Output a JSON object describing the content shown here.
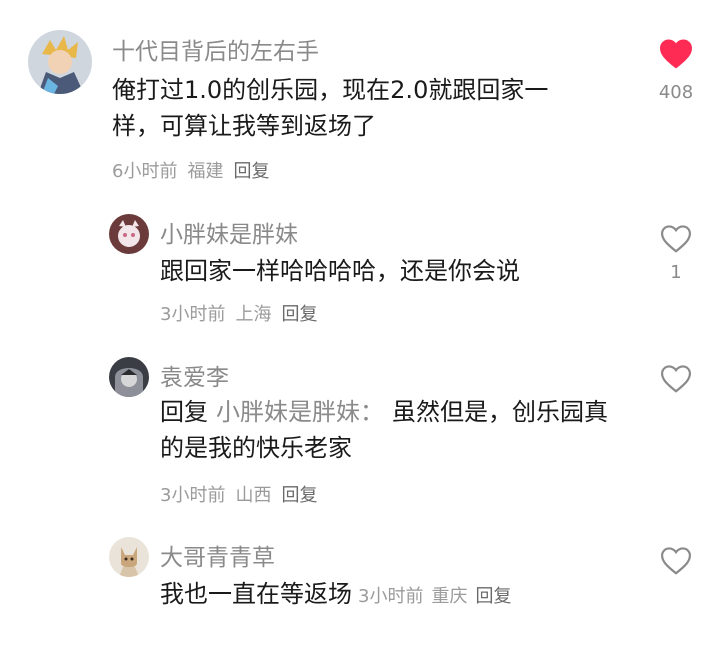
{
  "comments": [
    {
      "username": "十代目背后的左右手",
      "text": "俺打过1.0的创乐园，现在2.0就跟回家一样，可算让我等到返场了",
      "time": "6小时前",
      "location": "福建",
      "reply_label": "回复",
      "likes": "408",
      "liked": true
    },
    {
      "username": "小胖妹是胖妹",
      "text": "跟回家一样哈哈哈哈，还是你会说",
      "time": "3小时前",
      "location": "上海",
      "reply_label": "回复",
      "likes": "1",
      "liked": false
    },
    {
      "username": "袁爱李",
      "reply_prefix": "回复",
      "reply_to": "小胖妹是胖妹：",
      "text": "虽然但是，创乐园真的是我的快乐老家",
      "time": "3小时前",
      "location": "山西",
      "reply_label": "回复",
      "likes": "",
      "liked": false
    },
    {
      "username": "大哥青青草",
      "text": "我也一直在等返场",
      "time": "3小时前",
      "location": "重庆",
      "reply_label": "回复",
      "likes": "",
      "liked": false
    }
  ],
  "colors": {
    "liked_heart": "#fe2c55",
    "outline_heart": "#8a8a8a",
    "username": "#8a8a8a",
    "text": "#1a1a1a",
    "meta": "#9b9b9b"
  }
}
